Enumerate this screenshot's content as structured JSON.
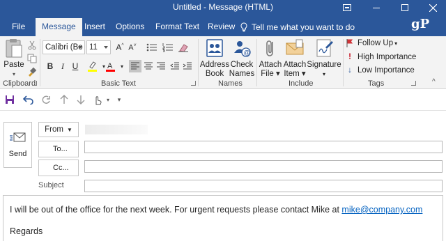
{
  "window": {
    "title": "Untitled  -  Message (HTML)"
  },
  "tabs": [
    {
      "label": "File"
    },
    {
      "label": "Message"
    },
    {
      "label": "Insert"
    },
    {
      "label": "Options"
    },
    {
      "label": "Format Text"
    },
    {
      "label": "Review"
    }
  ],
  "tellme": "Tell me what you want to do",
  "logo": "gP",
  "ribbon": {
    "clipboard": {
      "label": "Clipboard",
      "paste": "Paste"
    },
    "basic_text": {
      "label": "Basic Text",
      "font_name": "Calibri (Bo",
      "font_size": "11",
      "bold": "B",
      "italic": "I",
      "underline": "U"
    },
    "names": {
      "label": "Names",
      "address_book": [
        "Address",
        "Book"
      ],
      "check_names": [
        "Check",
        "Names"
      ]
    },
    "include": {
      "label": "Include",
      "attach_file": [
        "Attach",
        "File"
      ],
      "attach_item": [
        "Attach",
        "Item"
      ],
      "signature": [
        "Signature",
        ""
      ]
    },
    "tags": {
      "label": "Tags",
      "follow_up": "Follow Up",
      "high_importance": "High Importance",
      "low_importance": "Low Importance"
    }
  },
  "compose": {
    "send": "Send",
    "from": "From",
    "to": "To...",
    "cc": "Cc...",
    "subject": "Subject",
    "to_value": "",
    "cc_value": "",
    "subject_value": ""
  },
  "body": {
    "line1_text": "I will be out of the office for the next week. For urgent requests please contact Mike at ",
    "line1_email": "mike@company.com",
    "line2": "Regards"
  },
  "colors": {
    "accent": "#2b579a",
    "link": "#0563c1",
    "highlight": "#ffff00",
    "font_color": "#ff0000",
    "follow_up_flag": "#d13438",
    "high_importance": "#c50f1f",
    "low_importance": "#2b579a"
  }
}
